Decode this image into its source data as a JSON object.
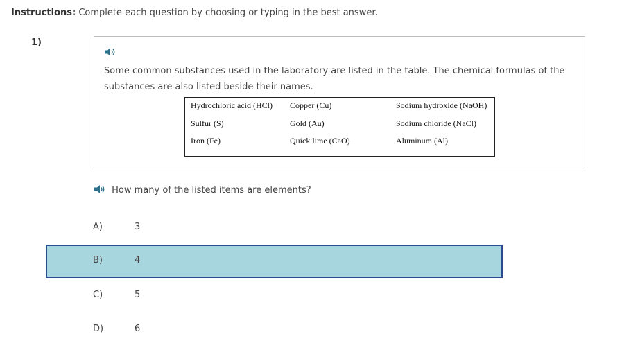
{
  "instructions": {
    "label": "Instructions:",
    "text": "Complete each question by choosing or typing in the best answer."
  },
  "question": {
    "number": "1)",
    "passage": "Some common substances used in the laboratory are listed in the table. The chemical formulas of the substances are also listed beside their names.",
    "table": [
      [
        "Hydrochloric acid (HCl)",
        "Copper (Cu)",
        "Sodium hydroxide (NaOH)"
      ],
      [
        "Sulfur (S)",
        "Gold (Au)",
        "Sodium chloride (NaCl)"
      ],
      [
        "Iron (Fe)",
        "Quick lime (CaO)",
        "Aluminum (Al)"
      ]
    ],
    "prompt": "How many of the listed items are elements?",
    "choices": [
      {
        "letter": "A)",
        "value": "3",
        "selected": false
      },
      {
        "letter": "B)",
        "value": "4",
        "selected": true
      },
      {
        "letter": "C)",
        "value": "5",
        "selected": false
      },
      {
        "letter": "D)",
        "value": "6",
        "selected": false
      }
    ]
  },
  "icons": {
    "audio": "speaker-icon"
  },
  "colors": {
    "selected_background": "#a7d6df",
    "selected_border": "#2c4a8f",
    "speaker": "#2e6f8a"
  }
}
